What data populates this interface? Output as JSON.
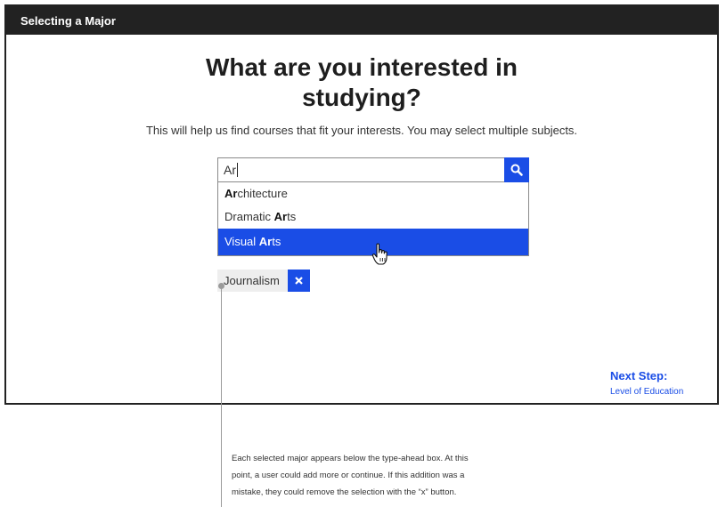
{
  "window": {
    "title": "Selecting a Major"
  },
  "heading": {
    "line1": "What are you interested in",
    "line2": "studying?"
  },
  "subtitle": "This will help us find courses that fit your interests. You may select multiple subjects.",
  "search": {
    "value": "Ar",
    "icon": "search-icon"
  },
  "suggestions": [
    {
      "match": "Ar",
      "prefix": "",
      "rest": "chitecture",
      "highlighted": false
    },
    {
      "match": "Ar",
      "prefix": "Dramatic ",
      "rest": "ts",
      "highlighted": false
    },
    {
      "match": "Ar",
      "prefix": "Visual ",
      "rest": "ts",
      "highlighted": true
    }
  ],
  "selected": [
    {
      "label": "Journalism",
      "remove_icon": "close-icon"
    }
  ],
  "next": {
    "label": "Next Step:",
    "link": "Level of Education"
  },
  "annotation": "Each selected major appears below the type-ahead box. At this point, a user could add more or continue. If this addition was a mistake, they could remove the selection with the “x” button.",
  "colors": {
    "accent": "#1a4de6",
    "titlebar": "#222222",
    "chip_bg": "#eeeeee"
  }
}
